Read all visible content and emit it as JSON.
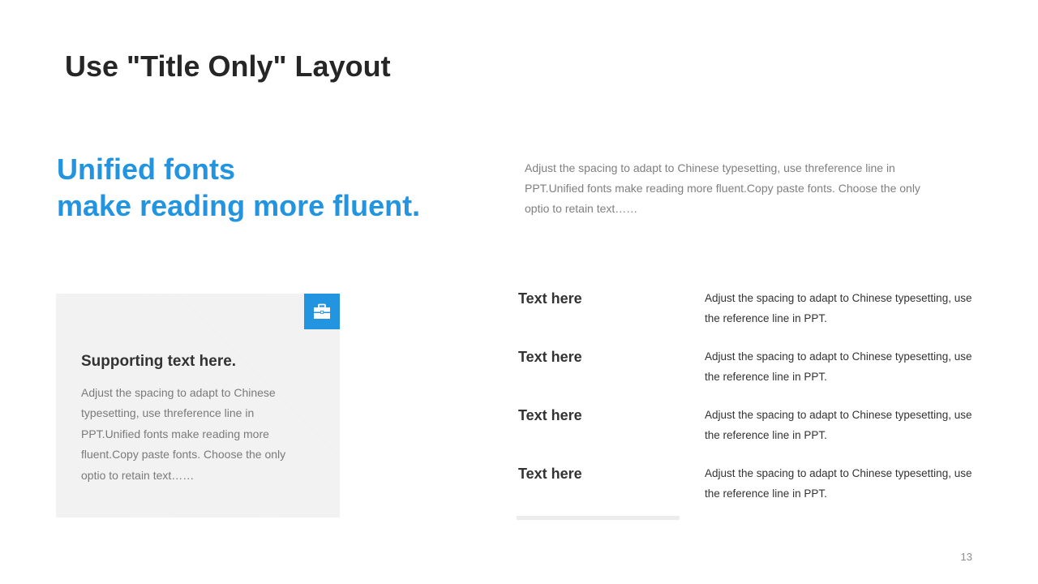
{
  "slide": {
    "title": "Use \"Title Only\" Layout",
    "page_number": "13"
  },
  "headline": {
    "line1": "Unified fonts",
    "line2": "make reading more fluent.",
    "accent_color": "#2394e0"
  },
  "intro": {
    "text": "Adjust the spacing to adapt to Chinese typesetting, use threference line in PPT.Unified fonts make reading more fluent.Copy paste fonts. Choose the only optio to retain text……"
  },
  "card": {
    "icon": "toolbox-icon",
    "heading": "Supporting text here.",
    "body": "Adjust the spacing to adapt to Chinese typesetting, use threference line in PPT.Unified fonts make reading more fluent.Copy paste fonts. Choose the only optio to retain text……"
  },
  "list": {
    "items": [
      {
        "label": "Text here",
        "description": "Adjust the spacing to adapt to Chinese typesetting, use the reference line in PPT."
      },
      {
        "label": "Text here",
        "description": "Adjust the spacing to adapt to Chinese typesetting, use the reference line in PPT."
      },
      {
        "label": "Text here",
        "description": "Adjust the spacing to adapt to Chinese typesetting, use the reference line in PPT."
      },
      {
        "label": "Text here",
        "description": "Adjust the spacing to adapt to Chinese typesetting, use the reference line in PPT."
      }
    ]
  }
}
